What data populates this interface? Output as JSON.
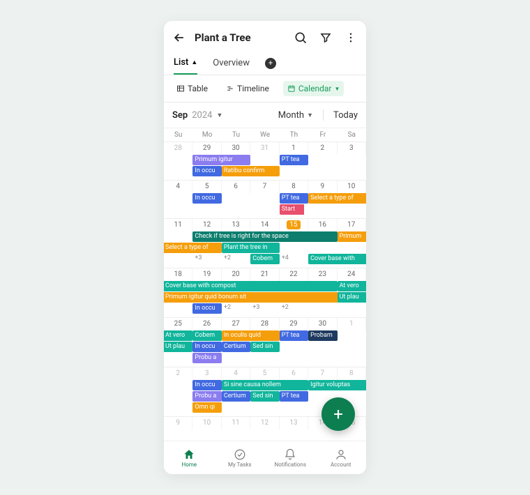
{
  "header": {
    "title": "Plant a Tree"
  },
  "tabs": {
    "list": "List",
    "overview": "Overview"
  },
  "viewbar": {
    "table": "Table",
    "timeline": "Timeline",
    "calendar": "Calendar"
  },
  "datebar": {
    "month": "Sep",
    "year": "2024",
    "range": "Month",
    "today": "Today"
  },
  "days": {
    "su": "Su",
    "mo": "Mo",
    "tu": "Tu",
    "we": "We",
    "th": "Th",
    "fr": "Fr",
    "sa": "Sa"
  },
  "weeks": [
    {
      "nums": [
        {
          "n": "28",
          "other": true
        },
        {
          "n": "29"
        },
        {
          "n": "30"
        },
        {
          "n": "31",
          "other": true
        },
        {
          "n": "1"
        },
        {
          "n": "2"
        },
        {
          "n": "3"
        }
      ],
      "rows": [
        [
          null,
          {
            "text": "Primum igitur",
            "color": "purple",
            "span": 2
          },
          null,
          null,
          {
            "text": "PT tea",
            "color": "blue",
            "span": 1
          },
          null,
          null
        ],
        [
          null,
          {
            "text": "In occu",
            "color": "blue",
            "span": 1
          },
          {
            "text": "Ratibu confirm",
            "color": "orange",
            "span": 2
          },
          null,
          null,
          null,
          null
        ]
      ]
    },
    {
      "nums": [
        {
          "n": "4"
        },
        {
          "n": "5"
        },
        {
          "n": "6"
        },
        {
          "n": "7"
        },
        {
          "n": "8"
        },
        {
          "n": "9"
        },
        {
          "n": "10"
        }
      ],
      "rows": [
        [
          null,
          {
            "text": "In occu",
            "color": "blue",
            "span": 1
          },
          null,
          null,
          {
            "text": "PT tea",
            "color": "blue",
            "span": 1
          },
          {
            "text": "Select a type of",
            "color": "orange",
            "span": 2,
            "extend": "right"
          },
          null
        ],
        [
          null,
          null,
          null,
          null,
          {
            "text": "Start",
            "color": "red",
            "span": 1,
            "flag": true
          },
          null,
          null
        ]
      ]
    },
    {
      "nums": [
        {
          "n": "11"
        },
        {
          "n": "12"
        },
        {
          "n": "13"
        },
        {
          "n": "14"
        },
        {
          "n": "15",
          "hl": true
        },
        {
          "n": "16"
        },
        {
          "n": "17"
        }
      ],
      "rows": [
        [
          null,
          {
            "text": "Check if tree is right for the space",
            "color": "dteal",
            "span": 5
          },
          null,
          null,
          null,
          null,
          {
            "text": "Primum",
            "color": "orange",
            "span": 1,
            "extend": "right"
          }
        ],
        [
          {
            "text": "Select a type of",
            "color": "orange",
            "span": 2,
            "extend": "left"
          },
          null,
          {
            "text": "Plant the tree in",
            "color": "teal",
            "span": 2
          },
          null,
          null,
          null,
          null
        ],
        [
          null,
          {
            "text": "+3",
            "more": true
          },
          {
            "text": "+2",
            "more": true
          },
          {
            "text": "Cobem",
            "color": "teal",
            "span": 1
          },
          {
            "text": "+4",
            "more": true
          },
          {
            "text": "Cover base with",
            "color": "teal",
            "span": 2,
            "extend": "right"
          },
          null
        ]
      ]
    },
    {
      "nums": [
        {
          "n": "18"
        },
        {
          "n": "19"
        },
        {
          "n": "20"
        },
        {
          "n": "21"
        },
        {
          "n": "22"
        },
        {
          "n": "23"
        },
        {
          "n": "24"
        }
      ],
      "rows": [
        [
          {
            "text": "Cover base with compost",
            "color": "teal",
            "span": 6,
            "extend": "left"
          },
          null,
          null,
          null,
          null,
          null,
          {
            "text": "At vero",
            "color": "teal",
            "span": 1,
            "extend": "right"
          }
        ],
        [
          {
            "text": "Primum igitur quid bonum sit",
            "color": "orange",
            "span": 6,
            "extend": "both"
          },
          null,
          null,
          null,
          null,
          null,
          {
            "text": "Ut plau",
            "color": "teal",
            "span": 1,
            "extend": "right"
          }
        ],
        [
          null,
          {
            "text": "In occu",
            "color": "blue",
            "span": 1
          },
          {
            "text": "+2",
            "more": true
          },
          {
            "text": "+3",
            "more": true
          },
          {
            "text": "+2",
            "more": true
          },
          null,
          null
        ]
      ]
    },
    {
      "nums": [
        {
          "n": "25"
        },
        {
          "n": "26"
        },
        {
          "n": "27"
        },
        {
          "n": "28"
        },
        {
          "n": "29"
        },
        {
          "n": "30"
        },
        {
          "n": "1",
          "other": true
        }
      ],
      "rows": [
        [
          {
            "text": "At vero",
            "color": "teal",
            "span": 1,
            "extend": "left"
          },
          {
            "text": "Cobem",
            "color": "teal",
            "span": 1
          },
          {
            "text": "In oculis quid",
            "color": "orange",
            "span": 2
          },
          {
            "text": "PT tea",
            "color": "blue",
            "span": 1,
            "offset": 4
          },
          {
            "text": "Probam",
            "color": "navy",
            "span": 1,
            "offset": 5
          },
          null
        ],
        [
          {
            "text": "Ut plau",
            "color": "teal",
            "span": 1,
            "extend": "left"
          },
          {
            "text": "In occu",
            "color": "blue",
            "span": 1
          },
          {
            "text": "Certium",
            "color": "blue",
            "span": 1
          },
          {
            "text": "Sed sin",
            "color": "teal",
            "span": 1
          },
          null,
          null,
          null
        ],
        [
          null,
          {
            "text": "Probu a",
            "color": "purple",
            "span": 1
          },
          null,
          null,
          null,
          null,
          null
        ]
      ]
    },
    {
      "nums": [
        {
          "n": "2",
          "other": true
        },
        {
          "n": "3",
          "other": true
        },
        {
          "n": "4",
          "other": true
        },
        {
          "n": "5",
          "other": true
        },
        {
          "n": "6",
          "other": true
        },
        {
          "n": "7",
          "other": true
        },
        {
          "n": "8",
          "other": true
        }
      ],
      "rows": [
        [
          null,
          {
            "text": "In occu",
            "color": "blue",
            "span": 1
          },
          {
            "text": "Si sine causa nollem",
            "color": "teal",
            "span": 3
          },
          null,
          null,
          {
            "text": "Igitur voluptas",
            "color": "teal",
            "span": 2,
            "extend": "right"
          },
          null
        ],
        [
          null,
          {
            "text": "Probu a",
            "color": "purple",
            "span": 1
          },
          {
            "text": "Certium",
            "color": "blue",
            "span": 1
          },
          {
            "text": "Sed sin",
            "color": "teal",
            "span": 1
          },
          {
            "text": "PT tea",
            "color": "blue",
            "span": 1
          },
          null,
          null
        ],
        [
          null,
          {
            "text": "Omn qi",
            "color": "orange",
            "span": 1
          },
          null,
          null,
          null,
          null,
          null
        ]
      ]
    },
    {
      "nums": [
        {
          "n": "9",
          "other": true
        },
        {
          "n": "10",
          "other": true
        },
        {
          "n": "11",
          "other": true
        },
        {
          "n": "12",
          "other": true
        },
        {
          "n": "13",
          "other": true
        },
        {
          "n": "14",
          "other": true
        },
        {
          "n": "15",
          "other": true
        }
      ],
      "rows": []
    }
  ],
  "botnav": {
    "home": "Home",
    "tasks": "My Tasks",
    "notifications": "Notifications",
    "account": "Account"
  }
}
